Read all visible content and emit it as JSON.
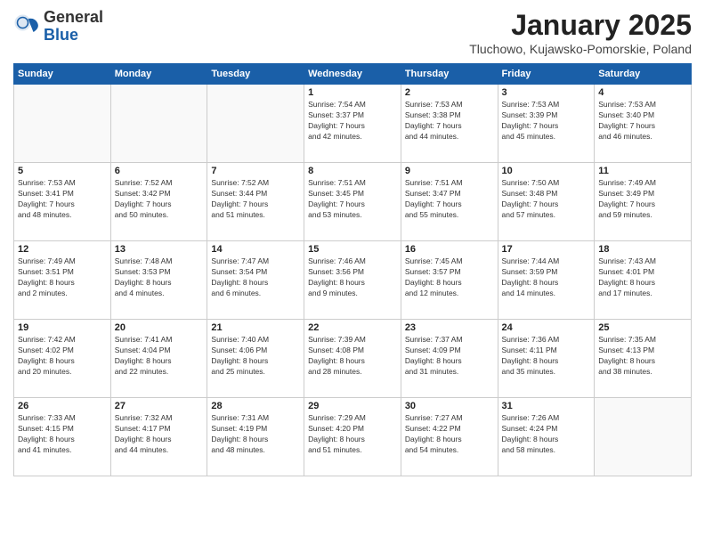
{
  "logo": {
    "general": "General",
    "blue": "Blue"
  },
  "title": "January 2025",
  "subtitle": "Tluchowo, Kujawsko-Pomorskie, Poland",
  "weekdays": [
    "Sunday",
    "Monday",
    "Tuesday",
    "Wednesday",
    "Thursday",
    "Friday",
    "Saturday"
  ],
  "weeks": [
    [
      {
        "day": "",
        "info": ""
      },
      {
        "day": "",
        "info": ""
      },
      {
        "day": "",
        "info": ""
      },
      {
        "day": "1",
        "info": "Sunrise: 7:54 AM\nSunset: 3:37 PM\nDaylight: 7 hours\nand 42 minutes."
      },
      {
        "day": "2",
        "info": "Sunrise: 7:53 AM\nSunset: 3:38 PM\nDaylight: 7 hours\nand 44 minutes."
      },
      {
        "day": "3",
        "info": "Sunrise: 7:53 AM\nSunset: 3:39 PM\nDaylight: 7 hours\nand 45 minutes."
      },
      {
        "day": "4",
        "info": "Sunrise: 7:53 AM\nSunset: 3:40 PM\nDaylight: 7 hours\nand 46 minutes."
      }
    ],
    [
      {
        "day": "5",
        "info": "Sunrise: 7:53 AM\nSunset: 3:41 PM\nDaylight: 7 hours\nand 48 minutes."
      },
      {
        "day": "6",
        "info": "Sunrise: 7:52 AM\nSunset: 3:42 PM\nDaylight: 7 hours\nand 50 minutes."
      },
      {
        "day": "7",
        "info": "Sunrise: 7:52 AM\nSunset: 3:44 PM\nDaylight: 7 hours\nand 51 minutes."
      },
      {
        "day": "8",
        "info": "Sunrise: 7:51 AM\nSunset: 3:45 PM\nDaylight: 7 hours\nand 53 minutes."
      },
      {
        "day": "9",
        "info": "Sunrise: 7:51 AM\nSunset: 3:47 PM\nDaylight: 7 hours\nand 55 minutes."
      },
      {
        "day": "10",
        "info": "Sunrise: 7:50 AM\nSunset: 3:48 PM\nDaylight: 7 hours\nand 57 minutes."
      },
      {
        "day": "11",
        "info": "Sunrise: 7:49 AM\nSunset: 3:49 PM\nDaylight: 7 hours\nand 59 minutes."
      }
    ],
    [
      {
        "day": "12",
        "info": "Sunrise: 7:49 AM\nSunset: 3:51 PM\nDaylight: 8 hours\nand 2 minutes."
      },
      {
        "day": "13",
        "info": "Sunrise: 7:48 AM\nSunset: 3:53 PM\nDaylight: 8 hours\nand 4 minutes."
      },
      {
        "day": "14",
        "info": "Sunrise: 7:47 AM\nSunset: 3:54 PM\nDaylight: 8 hours\nand 6 minutes."
      },
      {
        "day": "15",
        "info": "Sunrise: 7:46 AM\nSunset: 3:56 PM\nDaylight: 8 hours\nand 9 minutes."
      },
      {
        "day": "16",
        "info": "Sunrise: 7:45 AM\nSunset: 3:57 PM\nDaylight: 8 hours\nand 12 minutes."
      },
      {
        "day": "17",
        "info": "Sunrise: 7:44 AM\nSunset: 3:59 PM\nDaylight: 8 hours\nand 14 minutes."
      },
      {
        "day": "18",
        "info": "Sunrise: 7:43 AM\nSunset: 4:01 PM\nDaylight: 8 hours\nand 17 minutes."
      }
    ],
    [
      {
        "day": "19",
        "info": "Sunrise: 7:42 AM\nSunset: 4:02 PM\nDaylight: 8 hours\nand 20 minutes."
      },
      {
        "day": "20",
        "info": "Sunrise: 7:41 AM\nSunset: 4:04 PM\nDaylight: 8 hours\nand 22 minutes."
      },
      {
        "day": "21",
        "info": "Sunrise: 7:40 AM\nSunset: 4:06 PM\nDaylight: 8 hours\nand 25 minutes."
      },
      {
        "day": "22",
        "info": "Sunrise: 7:39 AM\nSunset: 4:08 PM\nDaylight: 8 hours\nand 28 minutes."
      },
      {
        "day": "23",
        "info": "Sunrise: 7:37 AM\nSunset: 4:09 PM\nDaylight: 8 hours\nand 31 minutes."
      },
      {
        "day": "24",
        "info": "Sunrise: 7:36 AM\nSunset: 4:11 PM\nDaylight: 8 hours\nand 35 minutes."
      },
      {
        "day": "25",
        "info": "Sunrise: 7:35 AM\nSunset: 4:13 PM\nDaylight: 8 hours\nand 38 minutes."
      }
    ],
    [
      {
        "day": "26",
        "info": "Sunrise: 7:33 AM\nSunset: 4:15 PM\nDaylight: 8 hours\nand 41 minutes."
      },
      {
        "day": "27",
        "info": "Sunrise: 7:32 AM\nSunset: 4:17 PM\nDaylight: 8 hours\nand 44 minutes."
      },
      {
        "day": "28",
        "info": "Sunrise: 7:31 AM\nSunset: 4:19 PM\nDaylight: 8 hours\nand 48 minutes."
      },
      {
        "day": "29",
        "info": "Sunrise: 7:29 AM\nSunset: 4:20 PM\nDaylight: 8 hours\nand 51 minutes."
      },
      {
        "day": "30",
        "info": "Sunrise: 7:27 AM\nSunset: 4:22 PM\nDaylight: 8 hours\nand 54 minutes."
      },
      {
        "day": "31",
        "info": "Sunrise: 7:26 AM\nSunset: 4:24 PM\nDaylight: 8 hours\nand 58 minutes."
      },
      {
        "day": "",
        "info": ""
      }
    ]
  ]
}
